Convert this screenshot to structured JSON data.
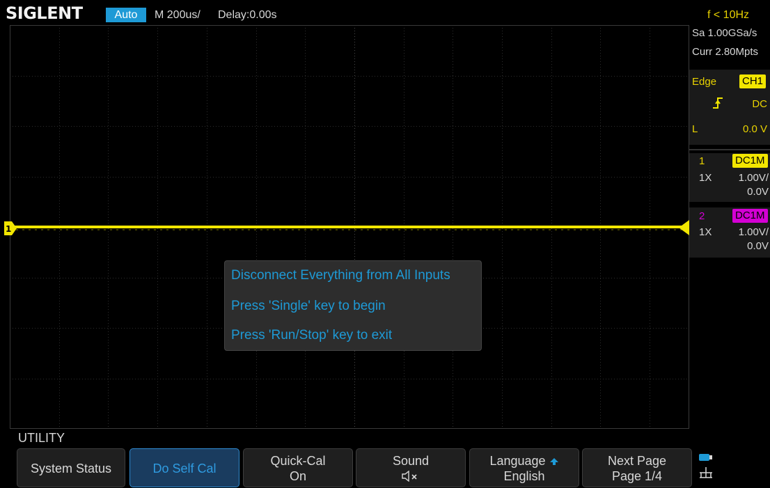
{
  "header": {
    "brand": "SIGLENT",
    "mode": "Auto",
    "timebase": "M 200us/",
    "delay": "Delay:0.00s",
    "frequency": "f < 10Hz"
  },
  "acquisition": {
    "sample_rate": "Sa 1.00GSa/s",
    "memory_depth": "Curr 2.80Mpts"
  },
  "trigger": {
    "type": "Edge",
    "source": "CH1",
    "coupling": "DC",
    "level_label": "L",
    "level": "0.0 V"
  },
  "channels": [
    {
      "number": "1",
      "coupling": "DC1M",
      "probe": "1X",
      "scale": "1.00V/",
      "offset": "0.0V",
      "color": "#f2e600"
    },
    {
      "number": "2",
      "coupling": "DC1M",
      "probe": "1X",
      "scale": "1.00V/",
      "offset": "0.0V",
      "color": "#d400d4"
    }
  ],
  "message": {
    "line1": "Disconnect Everything from All Inputs",
    "line2": "Press 'Single' key to begin",
    "line3": "Press 'Run/Stop' key to exit"
  },
  "menu": {
    "title": "UTILITY",
    "buttons": [
      {
        "line1": "System Status",
        "line2": ""
      },
      {
        "line1": "Do Self Cal",
        "line2": ""
      },
      {
        "line1": "Quick-Cal",
        "line2": "On"
      },
      {
        "line1": "Sound",
        "line2": ""
      },
      {
        "line1": "Language",
        "line2": "English"
      },
      {
        "line1": "Next Page",
        "line2": "Page 1/4"
      }
    ]
  },
  "colors": {
    "accent": "#1e9ad6",
    "channel1": "#f2e600",
    "channel2": "#d400d4"
  },
  "icons": {
    "trigger_position": "down-triangle-icon",
    "trigger_slope": "rising-edge-icon",
    "ch1_marker": "channel-1-marker-icon",
    "trigger_level": "trigger-level-arrow-icon",
    "sound": "speaker-muted-icon",
    "language_arrow": "up-arrow-icon",
    "usb": "usb-storage-icon",
    "network": "network-icon"
  }
}
